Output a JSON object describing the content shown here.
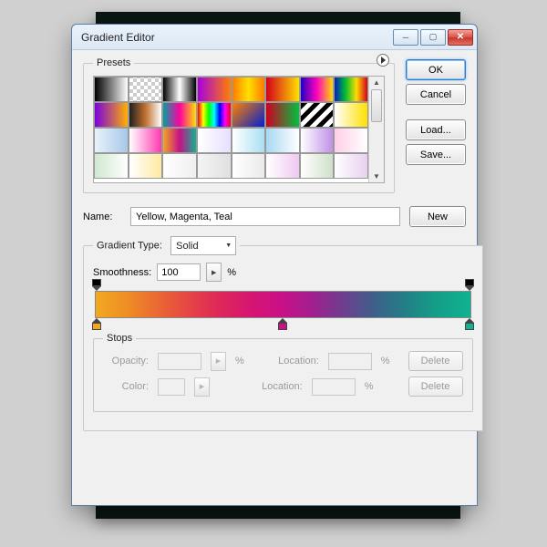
{
  "window": {
    "title": "Gradient Editor"
  },
  "buttons": {
    "ok": "OK",
    "cancel": "Cancel",
    "load": "Load...",
    "save": "Save...",
    "new": "New",
    "delete": "Delete"
  },
  "presets": {
    "legend": "Presets"
  },
  "name": {
    "label": "Name:",
    "value": "Yellow, Magenta, Teal"
  },
  "gradientType": {
    "label": "Gradient Type:",
    "value": "Solid"
  },
  "smoothness": {
    "label": "Smoothness:",
    "value": "100",
    "unit": "%"
  },
  "stops": {
    "legend": "Stops",
    "opacity": "Opacity:",
    "color": "Color:",
    "location": "Location:",
    "unit": "%"
  },
  "gradient": {
    "colorStops": [
      {
        "pos": 0,
        "color": "#f0a820"
      },
      {
        "pos": 50,
        "color": "#c81088"
      },
      {
        "pos": 100,
        "color": "#0fb291"
      }
    ],
    "opacityStops": [
      {
        "pos": 0,
        "opacity": 100
      },
      {
        "pos": 100,
        "opacity": 100
      }
    ]
  }
}
